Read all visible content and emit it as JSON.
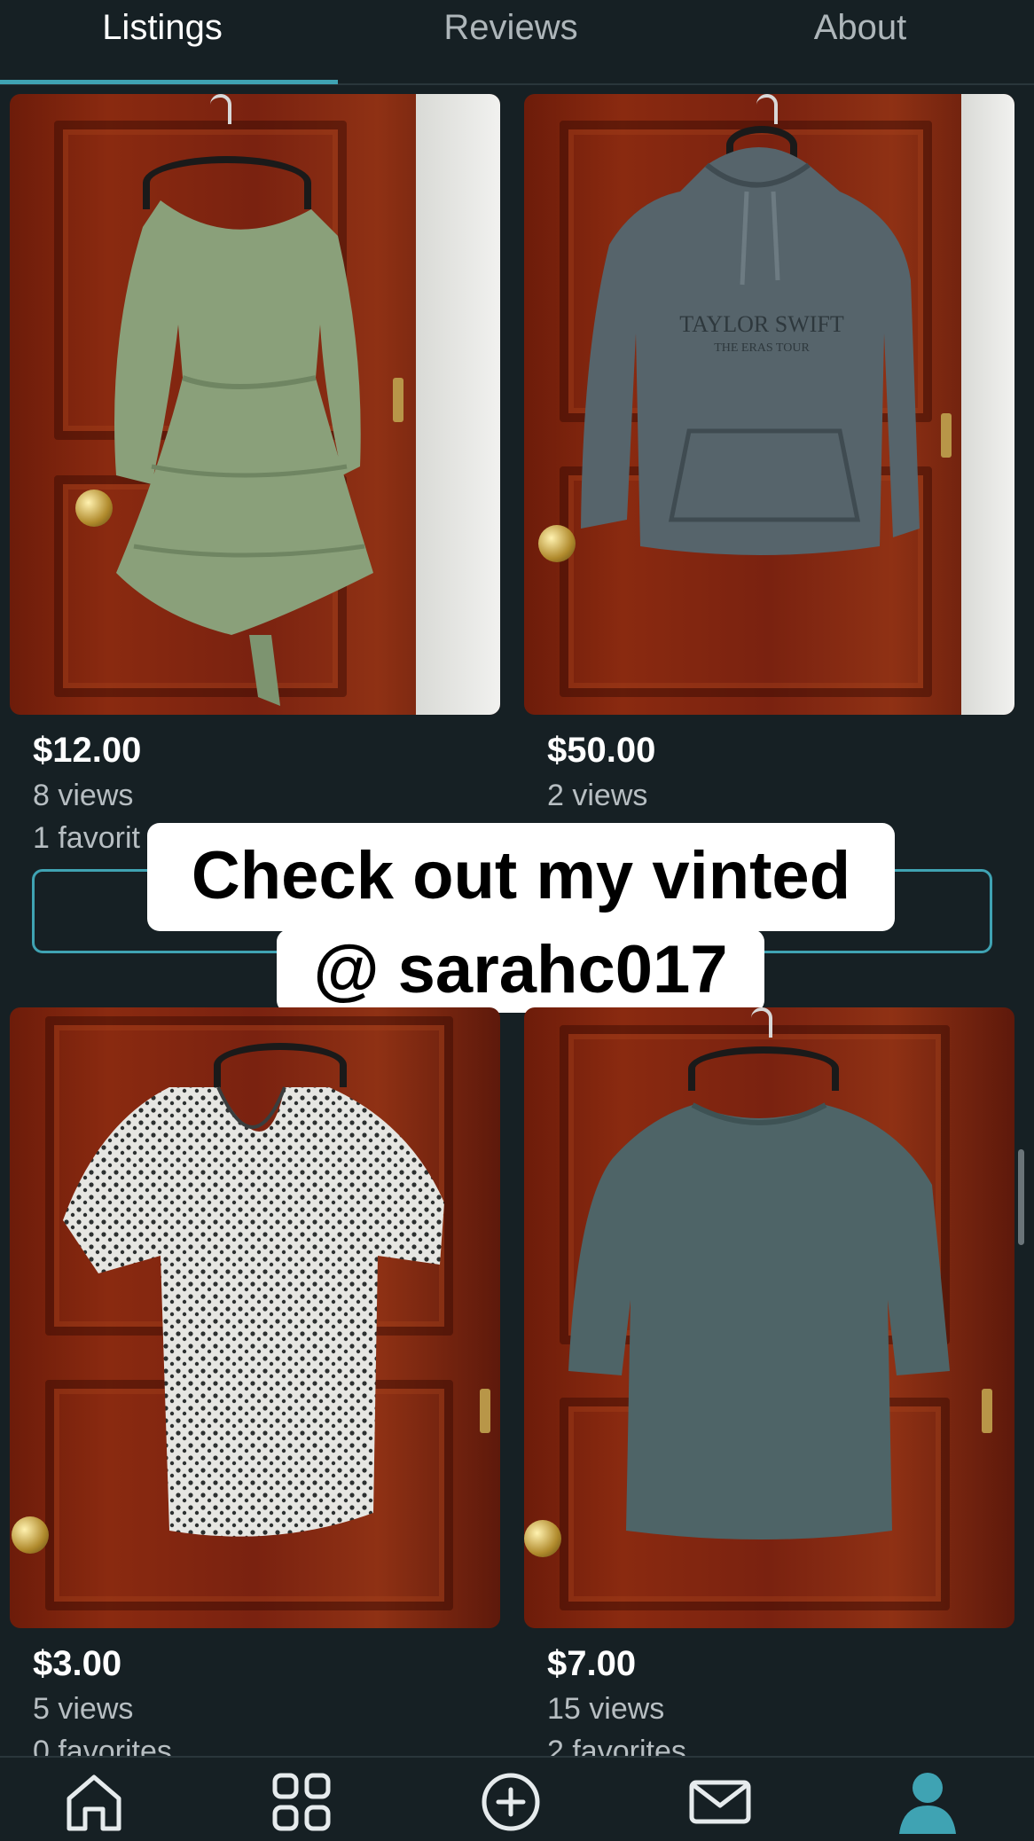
{
  "tabs": {
    "items": [
      {
        "label": "Listings",
        "active": true
      },
      {
        "label": "Reviews",
        "active": false
      },
      {
        "label": "About",
        "active": false
      }
    ]
  },
  "listings": [
    {
      "price": "$12.00",
      "views": "8 views",
      "favorites": "1 favorit",
      "item": "green-dress"
    },
    {
      "price": "$50.00",
      "views": "2 views",
      "favorites": "",
      "item": "gray-hoodie"
    },
    {
      "price": "$3.00",
      "views": "5 views",
      "favorites": "0 favorites",
      "item": "dotted-shirt"
    },
    {
      "price": "$7.00",
      "views": "15 views",
      "favorites": "2 favorites",
      "item": "teal-shirt"
    }
  ],
  "hoodie_print": {
    "line1": "TAYLOR SWIFT",
    "line2": "THE ERAS TOUR"
  },
  "overlay": {
    "line1": "Check out my vinted",
    "line2": "@ sarahc017"
  },
  "bottom_nav": {
    "items": [
      "home-icon",
      "catalog-grid-icon",
      "sell-plus-icon",
      "inbox-mail-icon",
      "profile-icon"
    ]
  },
  "colors": {
    "background": "#162024",
    "accent": "#3fa3b3",
    "text_primary": "#ffffff",
    "text_secondary": "#b7bec2"
  }
}
